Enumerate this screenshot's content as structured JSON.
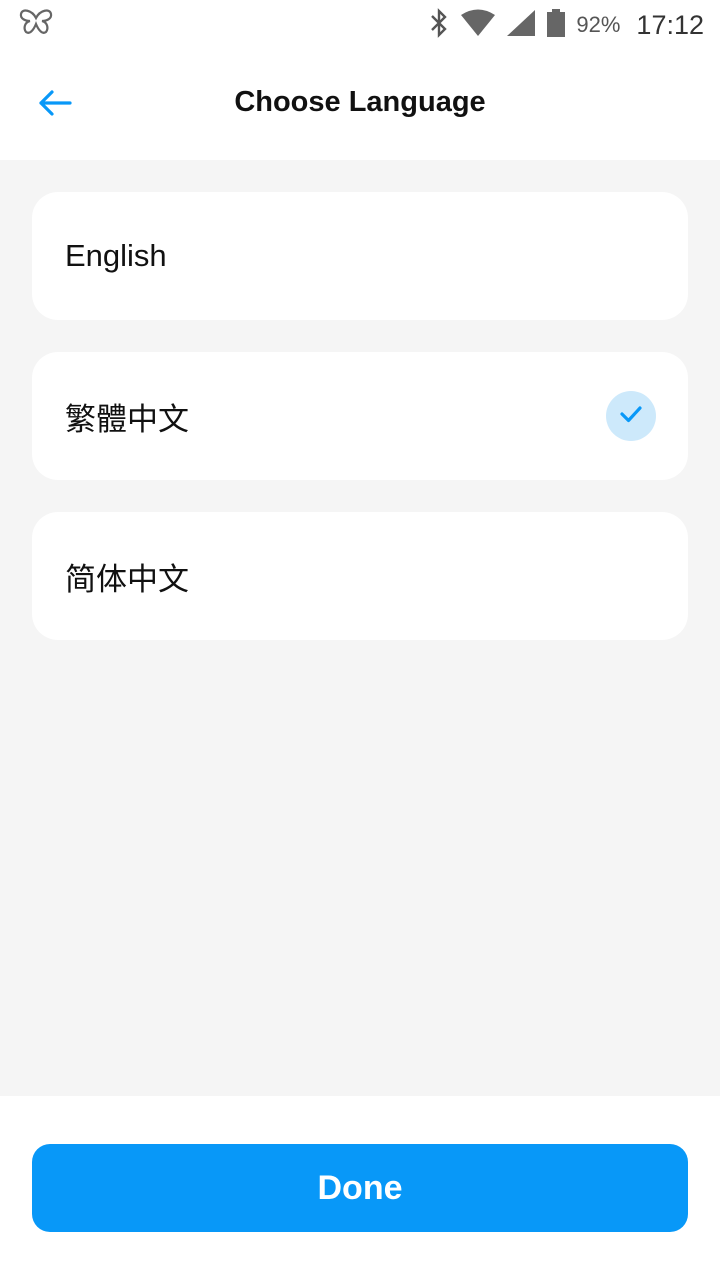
{
  "status_bar": {
    "battery_percent": "92%",
    "time": "17:12",
    "icons": [
      "butterfly-icon",
      "bluetooth-icon",
      "wifi-icon",
      "signal-icon",
      "battery-icon"
    ]
  },
  "header": {
    "title": "Choose Language",
    "back_icon": "arrow-left-icon"
  },
  "languages": [
    {
      "label": "English",
      "selected": false
    },
    {
      "label": "繁體中文",
      "selected": true
    },
    {
      "label": "简体中文",
      "selected": false
    }
  ],
  "footer": {
    "done_label": "Done"
  },
  "colors": {
    "accent": "#0898f8",
    "check_bg": "#cde9fb",
    "background": "#f5f5f5"
  }
}
